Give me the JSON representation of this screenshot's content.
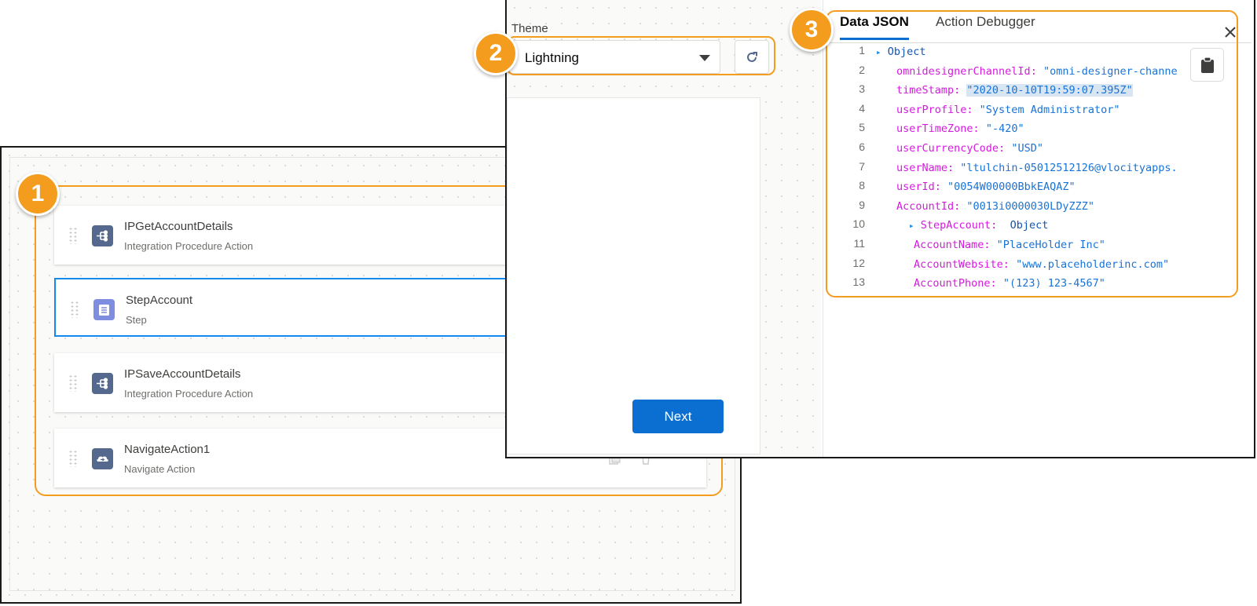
{
  "badges": [
    "1",
    "2",
    "3"
  ],
  "canvas": {
    "cards": [
      {
        "title": "IPGetAccountDetails",
        "subtitle": "Integration Procedure Action",
        "icon": "integration-procedure-icon",
        "selected": false
      },
      {
        "title": "StepAccount",
        "subtitle": "Step",
        "icon": "step-icon",
        "selected": true
      },
      {
        "title": "IPSaveAccountDetails",
        "subtitle": "Integration Procedure Action",
        "icon": "integration-procedure-icon",
        "selected": false
      },
      {
        "title": "NavigateAction1",
        "subtitle": "Navigate Action",
        "icon": "navigate-icon",
        "selected": false
      }
    ]
  },
  "preview": {
    "theme_label": "Theme",
    "theme_value": "Lightning",
    "next_label": "Next"
  },
  "json_panel": {
    "tabs": [
      "Data JSON",
      "Action Debugger"
    ],
    "active_tab": "Data JSON",
    "lines": [
      {
        "n": "1",
        "arrow": "▸",
        "key": "",
        "sep": "",
        "value": "Object",
        "kind": "obj"
      },
      {
        "n": "2",
        "arrow": "",
        "key": "omnidesignerChannelId",
        "sep": ": ",
        "value": "\"omni-designer-channe",
        "kind": "val"
      },
      {
        "n": "3",
        "arrow": "",
        "key": "timeStamp",
        "sep": ": ",
        "value": "\"2020-10-10T19:59:07.395Z\"",
        "kind": "val"
      },
      {
        "n": "4",
        "arrow": "",
        "key": "userProfile",
        "sep": ": ",
        "value": "\"System Administrator\"",
        "kind": "val"
      },
      {
        "n": "5",
        "arrow": "",
        "key": "userTimeZone",
        "sep": ": ",
        "value": "\"-420\"",
        "kind": "val"
      },
      {
        "n": "6",
        "arrow": "",
        "key": "userCurrencyCode",
        "sep": ": ",
        "value": "\"USD\"",
        "kind": "val"
      },
      {
        "n": "7",
        "arrow": "",
        "key": "userName",
        "sep": ": ",
        "value": "\"ltulchin-05012512126@vlocityapps.",
        "kind": "val"
      },
      {
        "n": "8",
        "arrow": "",
        "key": "userId",
        "sep": ": ",
        "value": "\"0054W00000BbkEAQAZ\"",
        "kind": "val"
      },
      {
        "n": "9",
        "arrow": "",
        "key": "AccountId",
        "sep": ": ",
        "value": "\"0013i0000030LDyZZZ\"",
        "kind": "val"
      },
      {
        "n": "10",
        "arrow": "▸",
        "key": "StepAccount",
        "sep": ":  ",
        "value": "Object",
        "kind": "obj"
      },
      {
        "n": "11",
        "arrow": "",
        "key": "AccountName",
        "sep": ": ",
        "value": "\"PlaceHolder Inc\"",
        "kind": "val"
      },
      {
        "n": "12",
        "arrow": "",
        "key": "AccountWebsite",
        "sep": ": ",
        "value": "\"www.placeholderinc.com\"",
        "kind": "val"
      },
      {
        "n": "13",
        "arrow": "",
        "key": "AccountPhone",
        "sep": ": ",
        "value": "\"(123) 123-4567\"",
        "kind": "val"
      }
    ]
  },
  "colors": {
    "highlight_orange": "#f39c1e",
    "brand_blue": "#0b6fd1",
    "json_key": "#d61ae0",
    "json_value": "#1973d6"
  }
}
